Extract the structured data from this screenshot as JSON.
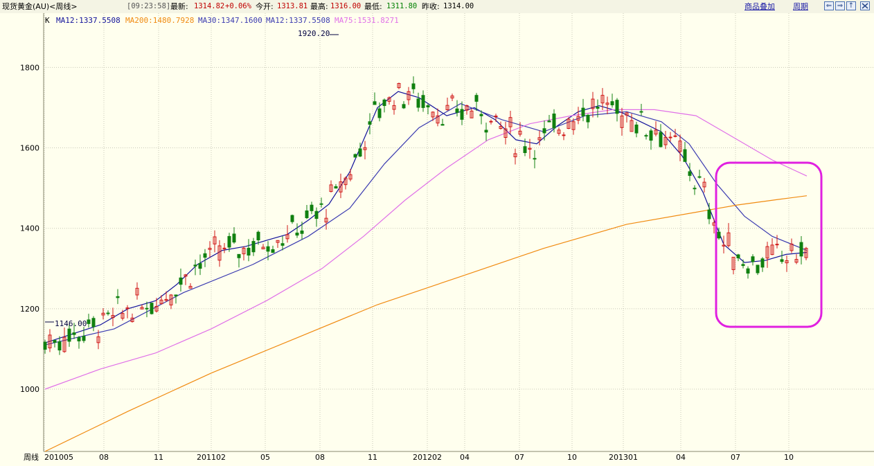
{
  "header": {
    "instrument": "现货黄金(AU)<周线>",
    "time": "[09:23:58]",
    "latest_label": "最新:",
    "latest_value": "1314.82",
    "change": "+0.06%",
    "open_label": "今开:",
    "open_value": "1313.81",
    "high_label": "最高:",
    "high_value": "1316.00",
    "low_label": "最低:",
    "low_value": "1311.80",
    "prevclose_label": "昨收:",
    "prevclose_value": "1314.00",
    "overlay_link": "商品叠加",
    "period_link": "周期",
    "nav_buttons": [
      "⇐",
      "⇒",
      "↑"
    ]
  },
  "legend": {
    "k_label": "K",
    "ma12": "MA12:1337.5508",
    "ma200": "MA200:1480.7928",
    "ma30": "MA30:1347.1600",
    "ma12b": "MA12:1337.5508",
    "ma75": "MA75:1531.8271"
  },
  "colors": {
    "up": "#d01818",
    "down": "#108010",
    "ma12": "#10109a",
    "ma30": "#3a3ab0",
    "ma75": "#e070e8",
    "ma200": "#f08a10",
    "highlight": "#e020e0",
    "grid": "#c8c8b8"
  },
  "chart_data": {
    "type": "candlestick",
    "period": "周线",
    "x_axis_title": "周线",
    "x_ticks": [
      "201005",
      "08",
      "11",
      "201102",
      "05",
      "08",
      "11",
      "201202",
      "04",
      "07",
      "10",
      "201301",
      "04",
      "07",
      "10"
    ],
    "y_ticks": [
      1000,
      1200,
      1400,
      1600,
      1800
    ],
    "ylim": [
      845,
      1935
    ],
    "annotations": [
      {
        "text": "1920.20",
        "kind": "max",
        "x_date": "2011-09"
      },
      {
        "text": "1146.00",
        "kind": "min",
        "x_date": "2010-05"
      }
    ],
    "highlight_region": {
      "from": "2013-06",
      "to": "2013-11",
      "color": "#e020e0"
    },
    "series": [
      {
        "name": "MA12",
        "values": [
          [
            0,
            1115
          ],
          [
            40,
            1160
          ],
          [
            60,
            1200
          ],
          [
            80,
            1220
          ],
          [
            95,
            1260
          ],
          [
            110,
            1310
          ],
          [
            128,
            1345
          ],
          [
            145,
            1355
          ],
          [
            160,
            1370
          ],
          [
            175,
            1385
          ],
          [
            190,
            1420
          ],
          [
            205,
            1460
          ],
          [
            220,
            1540
          ],
          [
            240,
            1700
          ],
          [
            255,
            1740
          ],
          [
            270,
            1725
          ],
          [
            290,
            1680
          ],
          [
            310,
            1700
          ],
          [
            325,
            1670
          ],
          [
            340,
            1620
          ],
          [
            355,
            1610
          ],
          [
            370,
            1655
          ],
          [
            385,
            1690
          ],
          [
            400,
            1705
          ],
          [
            415,
            1690
          ],
          [
            430,
            1665
          ],
          [
            445,
            1640
          ],
          [
            460,
            1580
          ],
          [
            475,
            1490
          ],
          [
            490,
            1360
          ],
          [
            505,
            1315
          ],
          [
            520,
            1320
          ],
          [
            535,
            1335
          ],
          [
            550,
            1340
          ]
        ]
      },
      {
        "name": "MA30",
        "values": [
          [
            0,
            1110
          ],
          [
            50,
            1150
          ],
          [
            100,
            1240
          ],
          [
            150,
            1310
          ],
          [
            190,
            1380
          ],
          [
            220,
            1450
          ],
          [
            245,
            1560
          ],
          [
            270,
            1650
          ],
          [
            300,
            1710
          ],
          [
            330,
            1670
          ],
          [
            360,
            1640
          ],
          [
            390,
            1680
          ],
          [
            420,
            1690
          ],
          [
            445,
            1665
          ],
          [
            465,
            1610
          ],
          [
            485,
            1510
          ],
          [
            505,
            1430
          ],
          [
            525,
            1380
          ],
          [
            550,
            1345
          ]
        ]
      },
      {
        "name": "MA75",
        "values": [
          [
            0,
            1000
          ],
          [
            40,
            1050
          ],
          [
            80,
            1090
          ],
          [
            120,
            1150
          ],
          [
            160,
            1220
          ],
          [
            200,
            1300
          ],
          [
            230,
            1380
          ],
          [
            260,
            1470
          ],
          [
            290,
            1550
          ],
          [
            320,
            1620
          ],
          [
            350,
            1660
          ],
          [
            380,
            1680
          ],
          [
            410,
            1695
          ],
          [
            440,
            1695
          ],
          [
            470,
            1680
          ],
          [
            500,
            1620
          ],
          [
            525,
            1570
          ],
          [
            550,
            1530
          ]
        ]
      },
      {
        "name": "MA200",
        "values": [
          [
            0,
            845
          ],
          [
            60,
            945
          ],
          [
            120,
            1040
          ],
          [
            180,
            1125
          ],
          [
            240,
            1210
          ],
          [
            300,
            1280
          ],
          [
            360,
            1350
          ],
          [
            420,
            1410
          ],
          [
            470,
            1440
          ],
          [
            500,
            1458
          ],
          [
            530,
            1472
          ],
          [
            550,
            1481
          ]
        ]
      }
    ],
    "ohlc_sample_latest": {
      "open": 1313.81,
      "high": 1316.0,
      "low": 1311.8,
      "close": 1314.82
    }
  }
}
